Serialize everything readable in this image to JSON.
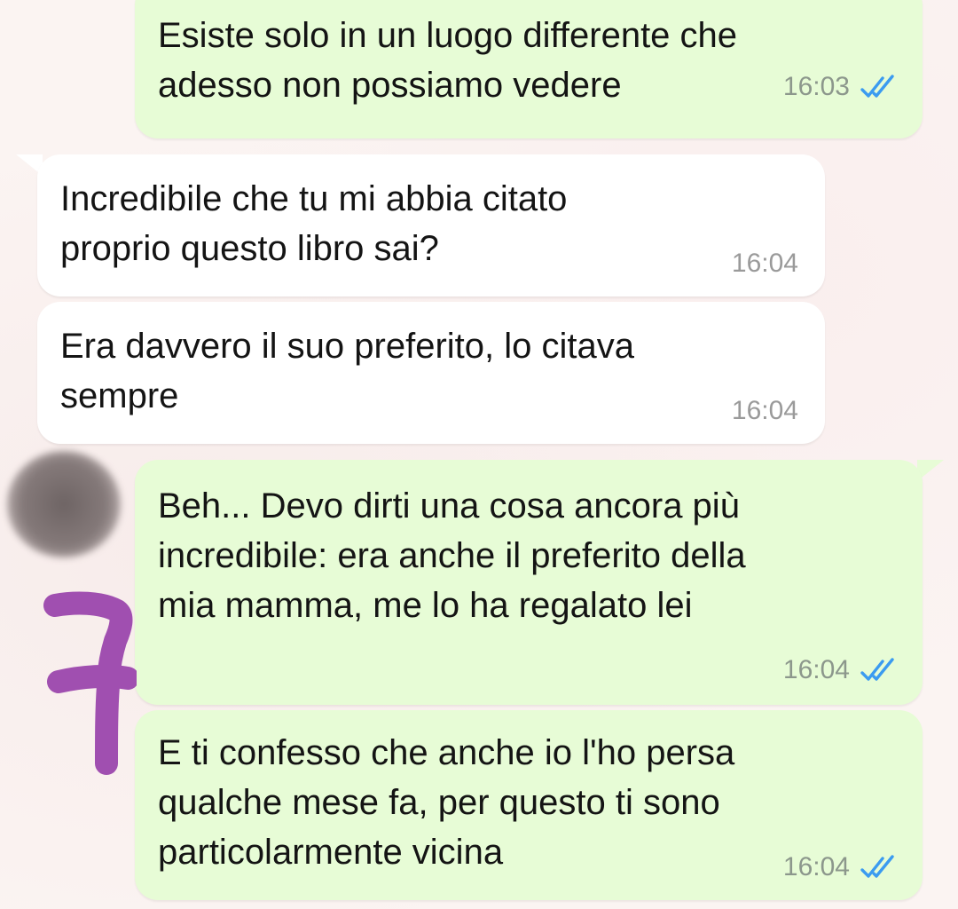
{
  "messages": [
    {
      "direction": "outgoing",
      "text": "Esiste solo in un luogo differente che\nadesso non possiamo vedere",
      "time": "16:03",
      "status": "read"
    },
    {
      "direction": "incoming",
      "text": "Incredibile che tu mi abbia citato\nproprio questo libro sai?",
      "time": "16:04"
    },
    {
      "direction": "incoming",
      "text": "Era davvero il suo preferito, lo citava\nsempre",
      "time": "16:04"
    },
    {
      "direction": "outgoing",
      "text": "Beh... Devo dirti una cosa ancora più\nincredibile: era anche il preferito della\nmia mamma, me lo ha regalato lei",
      "time": "16:04",
      "status": "read"
    },
    {
      "direction": "outgoing",
      "text": "E ti confesso che anche io l'ho persa\nqualche mese fa, per questo ti sono\nparticolarmente vicina",
      "time": "16:04",
      "status": "read"
    }
  ],
  "annotation": {
    "handwritten_number": "7",
    "color": "#a04fb0"
  },
  "colors": {
    "outgoing_bubble": "#e7fcd6",
    "incoming_bubble": "#ffffff",
    "read_ticks": "#3b9bf0",
    "background": "#fbf4f2"
  },
  "icons": {
    "read_status": "double-check-icon"
  }
}
